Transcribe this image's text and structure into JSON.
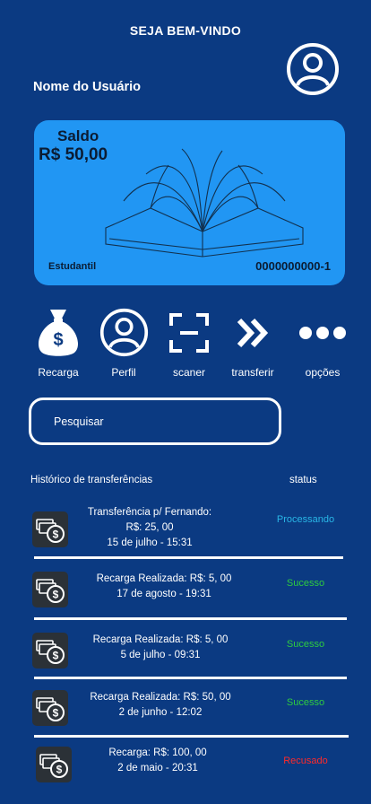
{
  "header": {
    "welcome": "SEJA BEM-VINDO",
    "username": "Nome do Usuário",
    "avatar_icon": "user-circle-icon"
  },
  "card": {
    "balance_label": "Saldo",
    "balance_value": "R$ 50,00",
    "type": "Estudantil",
    "number": "0000000000-1",
    "color": "#2196f3",
    "illustration": "open-book-icon"
  },
  "actions": [
    {
      "label": "Recarga",
      "icon": "money-bag-icon"
    },
    {
      "label": "Perfil",
      "icon": "user-circle-icon"
    },
    {
      "label": "scaner",
      "icon": "scan-icon"
    },
    {
      "label": "transferir",
      "icon": "double-chevron-right-icon"
    },
    {
      "label": "opções",
      "icon": "more-dots-icon"
    }
  ],
  "search": {
    "placeholder": "Pesquisar"
  },
  "history": {
    "title": "Histórico  de transferências",
    "status_header": "status",
    "items": [
      {
        "line1": "Transferência p/ Fernando:",
        "line2": "R$: 25, 00",
        "line3": "15 de julho - 15:31",
        "status": "Processando",
        "status_color": "#29b6e6"
      },
      {
        "line1": "Recarga Realizada: R$: 5, 00",
        "line2": "17 de agosto - 19:31",
        "status": "Sucesso",
        "status_color": "#2ecc40"
      },
      {
        "line1": "Recarga Realizada: R$: 5, 00",
        "line2": "5 de julho - 09:31",
        "status": "Sucesso",
        "status_color": "#2ecc40"
      },
      {
        "line1": "Recarga Realizada: R$: 50, 00",
        "line2": "2 de junho - 12:02",
        "status": "Sucesso",
        "status_color": "#2ecc40"
      },
      {
        "line1": "Recarga: R$: 100, 00",
        "line2": "2 de maio - 20:31",
        "status": "Recusado",
        "status_color": "#ff2a2a"
      }
    ]
  }
}
